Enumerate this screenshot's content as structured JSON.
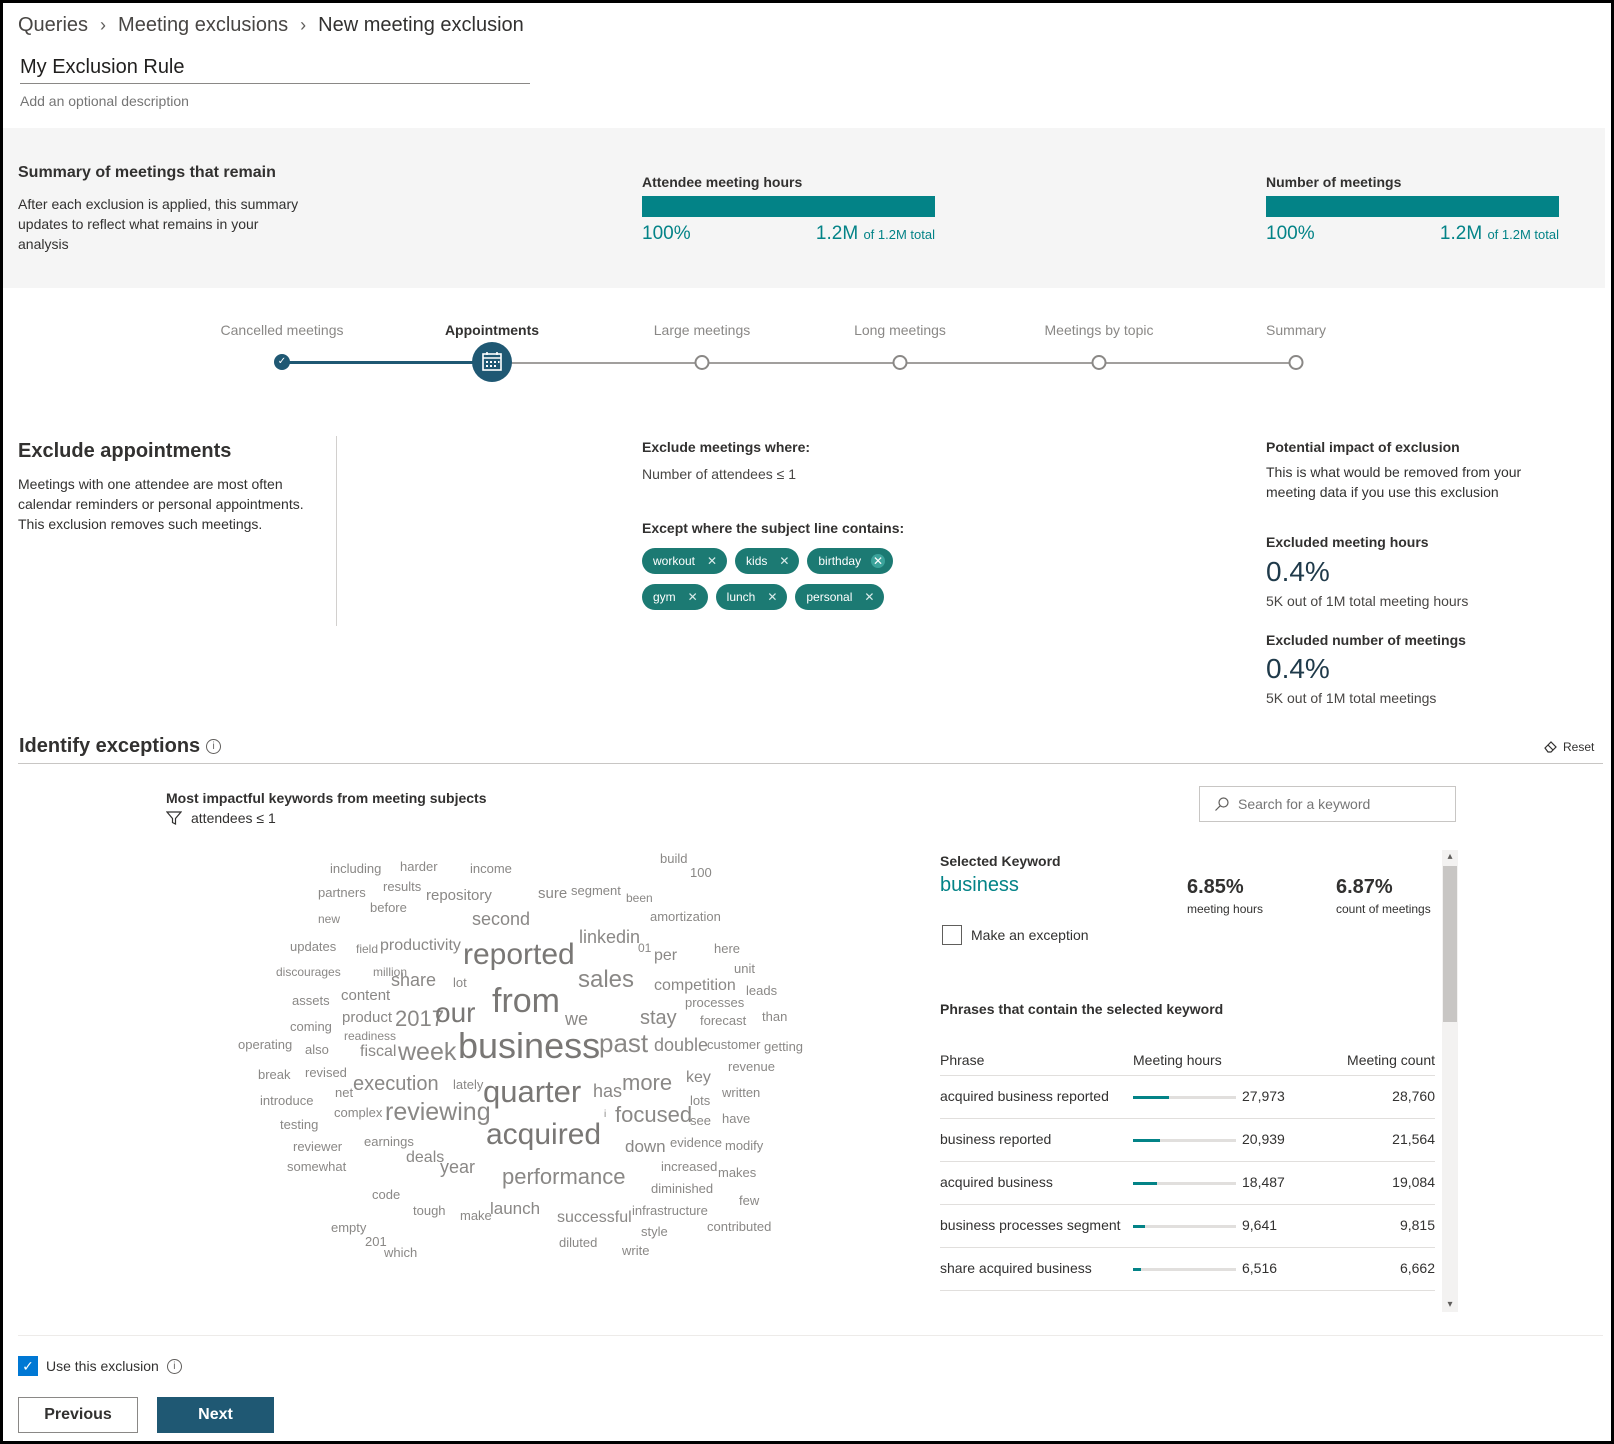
{
  "breadcrumb": [
    "Queries",
    "Meeting exclusions",
    "New meeting exclusion"
  ],
  "rule": {
    "name": "My Exclusion Rule",
    "description_placeholder": "Add an optional description"
  },
  "summary": {
    "title": "Summary of meetings that remain",
    "text": "After each exclusion is applied, this summary updates to reflect what remains in your analysis",
    "metrics": [
      {
        "title": "Attendee meeting hours",
        "percent": "100%",
        "value": "1.2M",
        "total": "of 1.2M total",
        "fill_fraction": 1.0
      },
      {
        "title": "Number of meetings",
        "percent": "100%",
        "value": "1.2M",
        "total": "of 1.2M total",
        "fill_fraction": 1.0
      }
    ]
  },
  "steps": [
    {
      "label": "Cancelled meetings",
      "state": "done"
    },
    {
      "label": "Appointments",
      "state": "active"
    },
    {
      "label": "Large meetings",
      "state": "todo"
    },
    {
      "label": "Long meetings",
      "state": "todo"
    },
    {
      "label": "Meetings by topic",
      "state": "todo"
    },
    {
      "label": "Summary",
      "state": "todo"
    }
  ],
  "exclude": {
    "title": "Exclude appointments",
    "text": "Meetings with one attendee are most often calendar reminders or personal appointments. This exclusion removes such meetings.",
    "where_label": "Exclude meetings where:",
    "where_value": "Number of attendees ≤ 1",
    "except_label": "Except where the subject line contains:",
    "keywords": [
      "workout",
      "kids",
      "birthday",
      "gym",
      "lunch",
      "personal"
    ]
  },
  "impact": {
    "title": "Potential impact of exclusion",
    "text": "This is what would be removed from your meeting data if you use this exclusion",
    "hours_label": "Excluded meeting hours",
    "hours_pct": "0.4%",
    "hours_note": "5K out of 1M total meeting hours",
    "meetings_label": "Excluded number of meetings",
    "meetings_pct": "0.4%",
    "meetings_note": "5K out of 1M total meetings"
  },
  "exceptions": {
    "title": "Identify exceptions",
    "reset_label": "Reset",
    "keywords_title": "Most impactful keywords from meeting subjects",
    "filter_text": "attendees ≤ 1",
    "search_placeholder": "Search for a keyword",
    "icons": {
      "info": "info-icon",
      "reset": "eraser-icon",
      "filter": "filter-icon",
      "search": "search-icon"
    }
  },
  "wordcloud": [
    "including",
    "harder",
    "income",
    "build",
    "100",
    "partners",
    "results",
    "repository",
    "sure",
    "segment",
    "been",
    "before",
    "new",
    "second",
    "amortization",
    "updates",
    "field",
    "productivity",
    "reported",
    "linkedin",
    "01",
    "per",
    "here",
    "discourages",
    "million",
    "share",
    "lot",
    "sales",
    "competition",
    "unit",
    "assets",
    "content",
    "from",
    "processes",
    "leads",
    "product",
    "2017",
    "our",
    "we",
    "stay",
    "forecast",
    "than",
    "coming",
    "readiness",
    "operating",
    "also",
    "fiscal",
    "week",
    "business",
    "past",
    "double",
    "customer",
    "getting",
    "revenue",
    "break",
    "revised",
    "execution",
    "lately",
    "quarter",
    "has",
    "more",
    "key",
    "net",
    "written",
    "introduce",
    "complex",
    "reviewing",
    "lots",
    "focused",
    "testing",
    "see",
    "have",
    "i",
    "acquired",
    "reviewer",
    "earnings",
    "down",
    "evidence",
    "modify",
    "somewhat",
    "deals",
    "year",
    "increased",
    "makes",
    "performance",
    "diminished",
    "code",
    "few",
    "tough",
    "make",
    "launch",
    "successful",
    "infrastructure",
    "empty",
    "contributed",
    "style",
    "201",
    "diluted",
    "which",
    "write"
  ],
  "selected": {
    "label": "Selected Keyword",
    "keyword": "business",
    "hours_pct": "6.85%",
    "hours_label": "meeting hours",
    "count_pct": "6.87%",
    "count_label": "count of meetings",
    "exception_label": "Make an exception",
    "phrases_title": "Phrases that contain the selected keyword",
    "columns": [
      "Phrase",
      "Meeting hours",
      "Meeting count"
    ],
    "rows": [
      {
        "phrase": "acquired business reported",
        "hours": "27,973",
        "count": "28,760",
        "hours_value": 27973
      },
      {
        "phrase": "business reported",
        "hours": "20,939",
        "count": "21,564",
        "hours_value": 20939
      },
      {
        "phrase": "acquired business",
        "hours": "18,487",
        "count": "19,084",
        "hours_value": 18487
      },
      {
        "phrase": "business processes segment",
        "hours": "9,641",
        "count": "9,815",
        "hours_value": 9641
      },
      {
        "phrase": "share acquired business",
        "hours": "6,516",
        "count": "6,662",
        "hours_value": 6516
      }
    ],
    "bar_max": 80000
  },
  "footer": {
    "use_label": "Use this exclusion",
    "use_checked": true,
    "prev_label": "Previous",
    "next_label": "Next"
  },
  "colors": {
    "accent": "#038387",
    "primary": "#1f5873",
    "pill": "#1c7a73"
  }
}
